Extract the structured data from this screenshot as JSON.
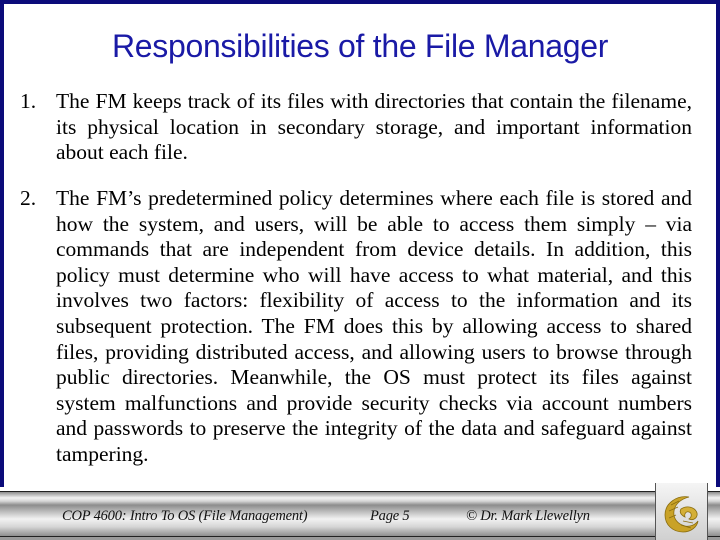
{
  "slide": {
    "title": "Responsibilities of the File Manager",
    "items": [
      {
        "number": "1.",
        "text": "The FM keeps track of its files with directories that contain the filename, its physical location in secondary storage, and important information about each file."
      },
      {
        "number": "2.",
        "text": "The FM’s predetermined policy determines where each file is stored and how the system, and users, will be able to access them simply – via commands that are independent from device details.  In addition, this policy must determine who will have access to what material, and this involves two factors: flexibility of access to the information and its subsequent protection.  The FM does this by allowing access to shared files, providing distributed access, and allowing users to browse through public directories.  Meanwhile, the OS must protect its files against system malfunctions and provide security checks via account numbers and passwords to preserve the integrity of the data and safeguard against tampering."
      }
    ]
  },
  "footer": {
    "course": "COP 4600: Intro To OS  (File Management)",
    "page": "Page 5",
    "copyright": "© Dr. Mark Llewellyn",
    "logo_icon": "pegasus-logo-icon"
  },
  "colors": {
    "frame": "#0b0b7a",
    "title": "#1a1aa6",
    "logo_gold": "#c9a227"
  }
}
